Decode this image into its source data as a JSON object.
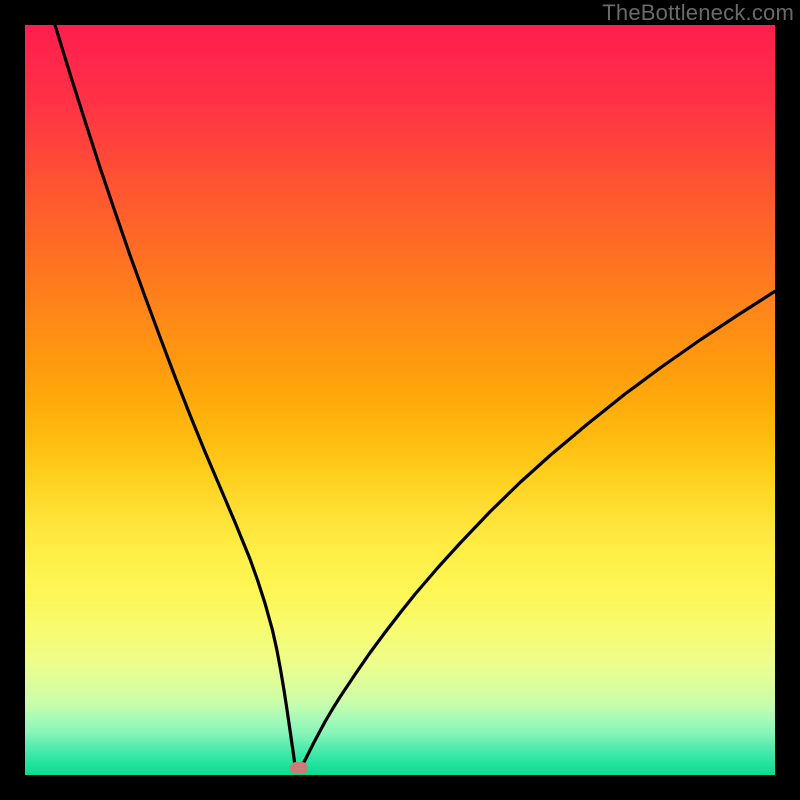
{
  "watermark": "TheBottleneck.com",
  "colors": {
    "frame": "#000000",
    "marker": "#cc7c78",
    "curve": "#000000"
  },
  "gradient_stops": [
    {
      "t": 0.0,
      "color": "#ff1e4e"
    },
    {
      "t": 0.1,
      "color": "#ff3246"
    },
    {
      "t": 0.2,
      "color": "#ff5034"
    },
    {
      "t": 0.3,
      "color": "#ff6e24"
    },
    {
      "t": 0.4,
      "color": "#ff8c16"
    },
    {
      "t": 0.45,
      "color": "#ff9a0e"
    },
    {
      "t": 0.5,
      "color": "#ffaa0c"
    },
    {
      "t": 0.55,
      "color": "#ffbc10"
    },
    {
      "t": 0.6,
      "color": "#ffcf1e"
    },
    {
      "t": 0.65,
      "color": "#ffe034"
    },
    {
      "t": 0.7,
      "color": "#ffee46"
    },
    {
      "t": 0.75,
      "color": "#fef654"
    },
    {
      "t": 0.8,
      "color": "#f8fb6c"
    },
    {
      "t": 0.85,
      "color": "#edfd8a"
    },
    {
      "t": 0.88,
      "color": "#dcfd9c"
    },
    {
      "t": 0.905,
      "color": "#c8fdac"
    },
    {
      "t": 0.925,
      "color": "#a6f9b6"
    },
    {
      "t": 0.945,
      "color": "#86f4b8"
    },
    {
      "t": 0.96,
      "color": "#5cecb0"
    },
    {
      "t": 0.975,
      "color": "#38e6a6"
    },
    {
      "t": 0.99,
      "color": "#18e19a"
    },
    {
      "t": 1.0,
      "color": "#06dd90"
    }
  ],
  "chart_data": {
    "type": "line",
    "title": "",
    "xlabel": "",
    "ylabel": "",
    "xlim": [
      0,
      100
    ],
    "ylim": [
      0,
      100
    ],
    "notch_x": 36,
    "marker": {
      "x": 36.5,
      "y": 0.9
    },
    "series": [
      {
        "name": "bottleneck-curve",
        "x": [
          4,
          6,
          8,
          10,
          12,
          14,
          16,
          18,
          20,
          22,
          24,
          26,
          28,
          30,
          31,
          32,
          33,
          33.6,
          34.1,
          34.55,
          34.95,
          35.3,
          35.6,
          35.85,
          36.0,
          36.3,
          36.7,
          37.0,
          37.4,
          37.9,
          38.5,
          39.2,
          40,
          41,
          42,
          44,
          46,
          48,
          50,
          52,
          55,
          58,
          62,
          66,
          70,
          75,
          80,
          85,
          90,
          95,
          100
        ],
        "y": [
          100,
          93.5,
          87.2,
          81.0,
          75.1,
          69.3,
          63.8,
          58.4,
          53.1,
          48.0,
          43.1,
          38.4,
          33.7,
          28.8,
          26.0,
          22.9,
          19.3,
          16.6,
          13.9,
          11.2,
          8.6,
          6.2,
          4.1,
          2.4,
          1.2,
          0.95,
          1.05,
          1.4,
          2.1,
          3.1,
          4.3,
          5.6,
          7.1,
          8.8,
          10.4,
          13.4,
          16.3,
          19.0,
          21.6,
          24.1,
          27.6,
          30.9,
          35.1,
          39.0,
          42.6,
          46.8,
          50.8,
          54.5,
          58.0,
          61.3,
          64.5
        ]
      }
    ]
  }
}
